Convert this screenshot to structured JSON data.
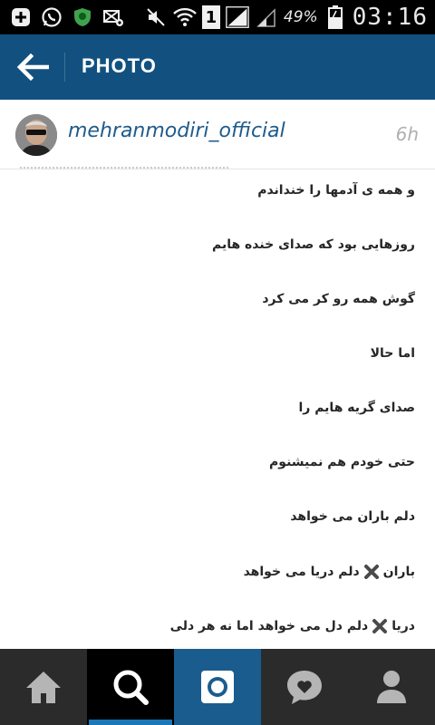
{
  "status_bar": {
    "sim_slot": "1",
    "battery_percent": "49%",
    "time": "03:16",
    "icons": [
      "notification-plus-icon",
      "whatsapp-icon",
      "security-shield-icon",
      "no-data-settings-icon",
      "mute-icon",
      "wifi-icon",
      "sim-1-icon",
      "signal-icon",
      "signal-2-icon",
      "battery-charging-icon"
    ]
  },
  "action_bar": {
    "title": "PHOTO",
    "back_icon": "arrow-left-icon",
    "background": "#12517f"
  },
  "post": {
    "username": "mehranmodiri_official",
    "time_ago": "6h",
    "username_color": "#1f5b8c"
  },
  "caption": {
    "lines": [
      {
        "text": "و همه ی آدمها را خنداندم"
      },
      {
        "text": "روزهایی بود که صدای خنده هایم"
      },
      {
        "text": "گوش همه رو کر می کرد"
      },
      {
        "text": "اما حالا"
      },
      {
        "text": "صدای گریه هایم را"
      },
      {
        "text": "حتی خودم هم نمیشنوم"
      },
      {
        "text": "دلم باران می خواهد"
      },
      {
        "text_before": "باران",
        "text_after": "دلم دریا می خواهد",
        "icon": "cross-mark-icon"
      },
      {
        "text_before": "دریا",
        "text_after": "دلم دل می خواهد اما نه هر دلی",
        "icon": "cross-mark-icon"
      }
    ]
  },
  "bottom_nav": {
    "items": [
      {
        "name": "home",
        "icon": "home-icon",
        "selected": false
      },
      {
        "name": "search",
        "icon": "search-icon",
        "selected": true
      },
      {
        "name": "camera",
        "icon": "camera-icon",
        "selected": false
      },
      {
        "name": "activity",
        "icon": "heart-bubble-icon",
        "selected": false
      },
      {
        "name": "profile",
        "icon": "person-icon",
        "selected": false
      }
    ],
    "accent": "#1b77b8"
  }
}
